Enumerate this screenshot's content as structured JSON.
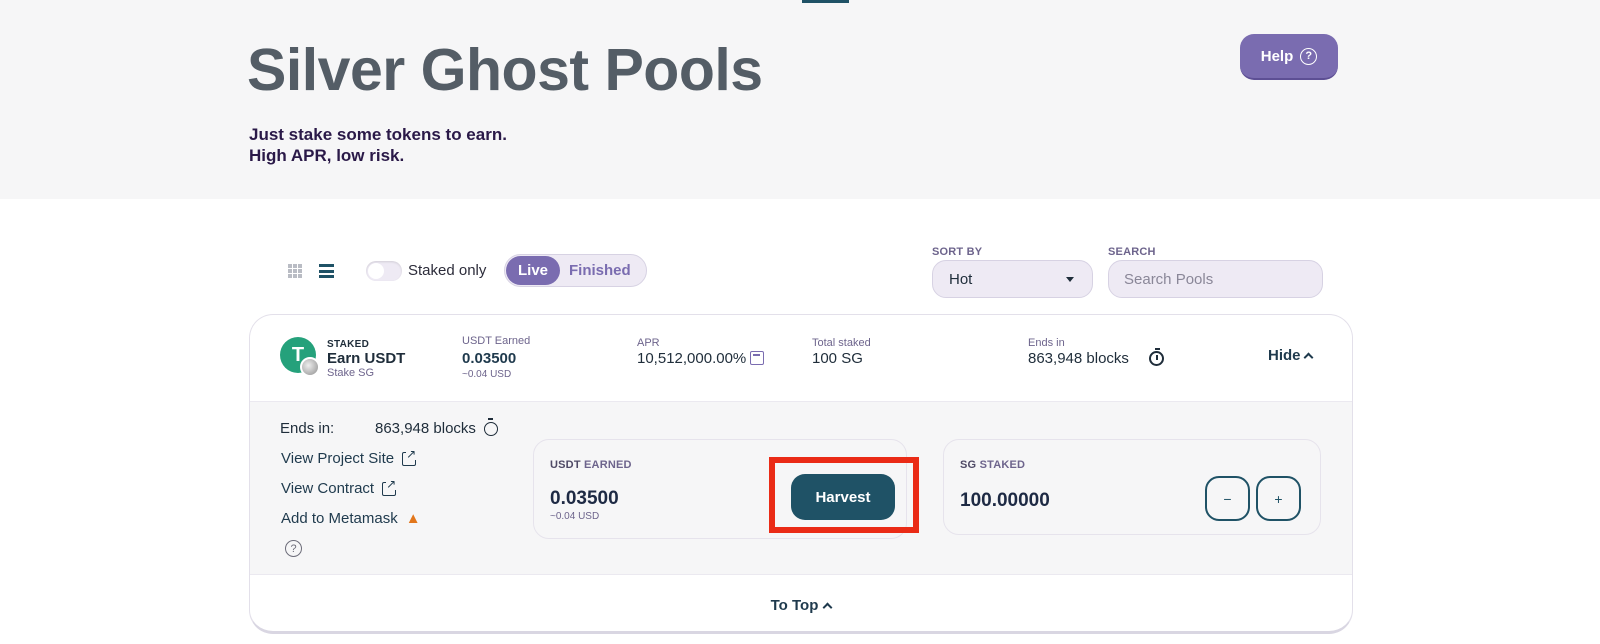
{
  "header": {
    "title": "Silver Ghost Pools",
    "subtitle_line1": "Just stake some tokens to earn.",
    "subtitle_line2": "High APR, low risk.",
    "help_label": "Help",
    "help_icon": "question-circle-icon"
  },
  "controls": {
    "staked_only_label": "Staked only",
    "staked_only_on": false,
    "live_label": "Live",
    "finished_label": "Finished",
    "sort_label": "SORT BY",
    "sort_value": "Hot",
    "search_label": "SEARCH",
    "search_placeholder": "Search Pools"
  },
  "pool": {
    "tag": "STAKED",
    "name": "Earn USDT",
    "stake_label": "Stake SG",
    "earned_label": "USDT Earned",
    "earned_value": "0.03500",
    "earned_usd": "~0.04 USD",
    "apr_label": "APR",
    "apr_value": "10,512,000.00%",
    "total_staked_label": "Total staked",
    "total_staked_value": "100 SG",
    "ends_label": "Ends in",
    "ends_value": "863,948 blocks",
    "hide_label": "Hide"
  },
  "details": {
    "ends_label": "Ends in:",
    "ends_value": "863,948 blocks",
    "project_site_label": "View Project Site",
    "contract_label": "View Contract",
    "metamask_label": "Add to Metamask",
    "earn_box_label_token": "USDT",
    "earn_box_label_rest": "EARNED",
    "earn_box_value": "0.03500",
    "earn_box_usd": "~0.04 USD",
    "harvest_label": "Harvest",
    "stake_box_label_token": "SG",
    "stake_box_label_rest": "STAKED",
    "stake_box_value": "100.00000",
    "minus_label": "−",
    "plus_label": "+"
  },
  "footer": {
    "to_top_label": "To Top"
  },
  "colors": {
    "accent_purple": "#7a6cb0",
    "primary_teal": "#1f5266",
    "highlight_red": "#ea2b16"
  }
}
